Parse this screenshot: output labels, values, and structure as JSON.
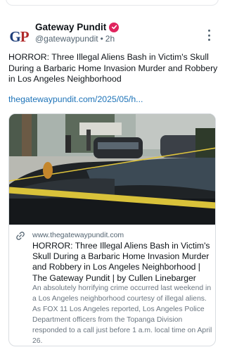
{
  "post": {
    "author": {
      "display_name": "Gateway Pundit",
      "handle": "@gatewaypundit",
      "separator": "•",
      "time": "2h",
      "avatar_initials_1": "G",
      "avatar_initials_2": "P",
      "verified_color": "#e0245e"
    },
    "text": "HORROR: Three Illegal Aliens Bash in Victim's Skull During a Barbaric Home Invasion Murder and Robbery in Los Angeles Neighborhood",
    "link_text": "thegatewaypundit.com/2025/05/h...",
    "link_color": "#1d73b8",
    "card": {
      "domain": "www.thegatewaypundit.com",
      "title": "HORROR: Three Illegal Aliens Bash in Victim's Skull During a Barbaric Home Invasion Murder and Robbery in Los Angeles Neighborhood | The Gateway Pundit | by Cullen Linebarger",
      "description": "An absolutely horrifying crime occurred last weekend in a Los Angeles neighborhood courtesy of illegal aliens. As FOX 11 Los Angeles reported, Los Angeles Police Department officers from the Topanga Division responded to a call just before 1 a.m. local time on April 26."
    }
  }
}
